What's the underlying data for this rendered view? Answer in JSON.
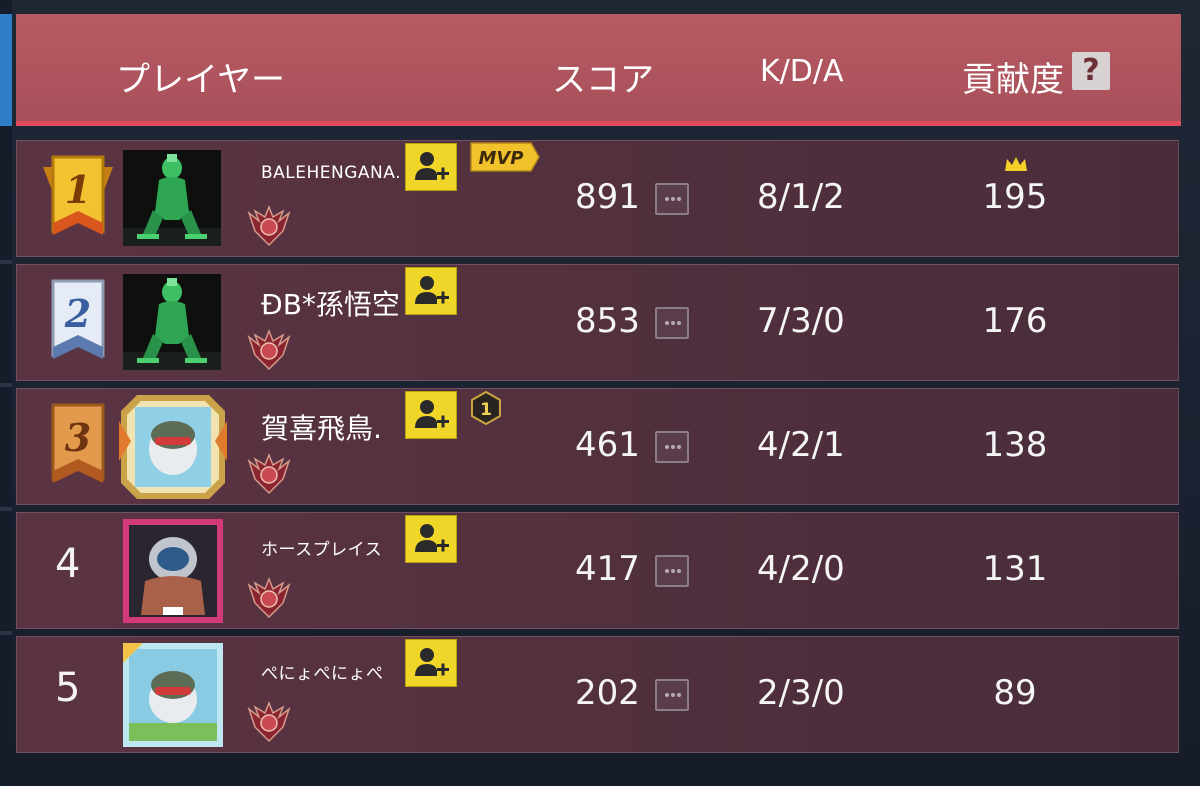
{
  "header": {
    "player": "プレイヤー",
    "score": "スコア",
    "kda": "K/D/A",
    "contribution": "貢献度",
    "help": "?"
  },
  "badges": {
    "mvp": "MVP",
    "first_kill": "1"
  },
  "players": [
    {
      "rank": "1",
      "name": "BALEHENGANA.",
      "score": "891",
      "kda": "8/1/2",
      "contribution": "195"
    },
    {
      "rank": "2",
      "name": "ÐB*孫悟空",
      "score": "853",
      "kda": "7/3/0",
      "contribution": "176"
    },
    {
      "rank": "3",
      "name": "賀喜飛鳥.",
      "score": "461",
      "kda": "4/2/1",
      "contribution": "138"
    },
    {
      "rank": "4",
      "name": "ホースプレイス",
      "score": "417",
      "kda": "4/2/0",
      "contribution": "131"
    },
    {
      "rank": "5",
      "name": "ぺにょぺにょぺ",
      "score": "202",
      "kda": "2/3/0",
      "contribution": "89"
    }
  ],
  "colors": {
    "header_bg": "#b0555e",
    "header_accent": "#e14d5a",
    "row_bg": "#55313f",
    "add_friend": "#f1d62a",
    "gold": "#e8b020",
    "silver": "#c9d2e2",
    "bronze": "#d5833a"
  }
}
